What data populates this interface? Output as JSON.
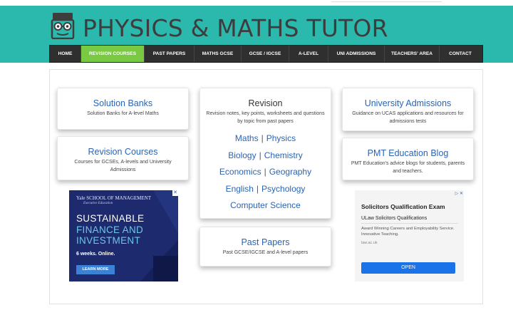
{
  "site": {
    "title": "PHYSICS & MATHS TUTOR",
    "logo_icon": "pmt-logo-icon",
    "header_color": "#2bb9ad",
    "nav_active_color": "#7ac943",
    "link_color": "#2a64b4"
  },
  "nav": {
    "items": [
      {
        "label": "HOME"
      },
      {
        "label": "REVISION COURSES"
      },
      {
        "label": "PAST PAPERS"
      },
      {
        "label": "MATHS GCSE"
      },
      {
        "label": "GCSE / IGCSE"
      },
      {
        "label": "A-LEVEL"
      },
      {
        "label": "UNI ADMISSIONS"
      },
      {
        "label": "TEACHERS' AREA"
      },
      {
        "label": "CONTACT"
      }
    ],
    "active": "REVISION COURSES"
  },
  "cards": {
    "solution_banks": {
      "title": "Solution Banks",
      "desc": "Solution Banks for A-level Maths"
    },
    "revision_courses": {
      "title": "Revision Courses",
      "desc": "Courses for GCSEs, A-levels and University Admissions"
    },
    "revision": {
      "title": "Revision",
      "desc": "Revision notes, key points, worksheets and questions by topic from past papers",
      "subjects": [
        "Maths",
        "Physics",
        "Biology",
        "Chemistry",
        "Economics",
        "Geography",
        "English",
        "Psychology",
        "Computer Science"
      ],
      "separator": "|"
    },
    "past_papers": {
      "title": "Past Papers",
      "desc": "Past GCSE/IGCSE and A-level papers"
    },
    "university_admissions": {
      "title": "University Admissions",
      "desc": "Guidance on UCAS applications and resources for admissions tests"
    },
    "pmt_blog": {
      "title": "PMT Education Blog",
      "desc": "PMT Education's advice blogs for students, parents and teachers."
    }
  },
  "ads": {
    "yale": {
      "logo": "Yale SCHOOL OF MANAGEMENT",
      "sub": "Executive Education",
      "line1": "SUSTAINABLE",
      "line2": "FINANCE AND",
      "line3": "INVESTMENT",
      "weeks": "6 weeks. Online.",
      "cta": "LEARN MORE",
      "close": "✕"
    },
    "sqe": {
      "title": "Solicitors Qualification Exam",
      "brand": "ULaw Solicitors Qualifications",
      "text": "Award Winning Careers and Employability Service. Innovative Teaching.",
      "url": "law.ac.uk",
      "cta": "OPEN",
      "close": "▷ ✕"
    }
  }
}
